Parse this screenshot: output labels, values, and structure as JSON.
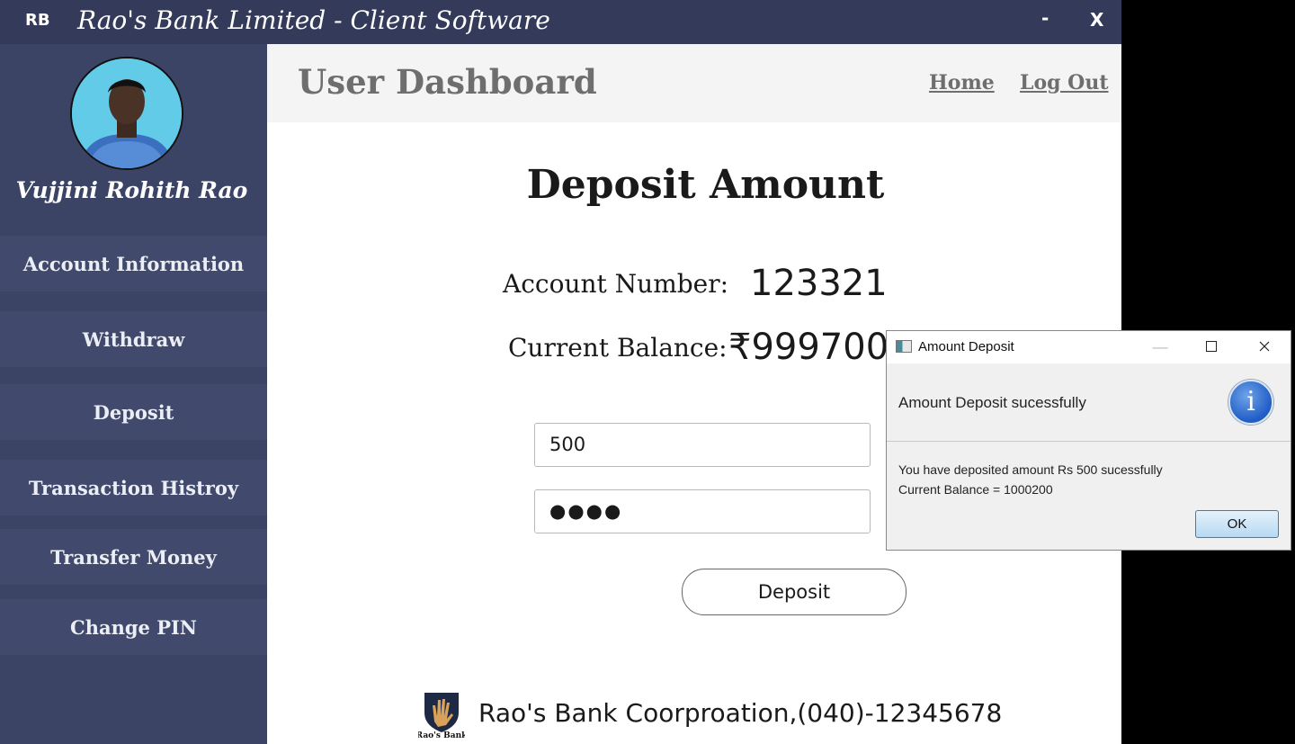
{
  "titlebar": {
    "logo": "RB",
    "title": "Rao's Bank Limited - Client Software",
    "minimize_label": "-",
    "close_label": "X"
  },
  "sidebar": {
    "user_name": "Vujjini Rohith Rao",
    "items": [
      {
        "label": "Account Information"
      },
      {
        "label": "Withdraw"
      },
      {
        "label": "Deposit"
      },
      {
        "label": "Transaction Histroy"
      },
      {
        "label": "Transfer Money"
      },
      {
        "label": "Change PIN"
      }
    ]
  },
  "header": {
    "title": "User Dashboard",
    "home_link": "Home",
    "logout_link": "Log Out"
  },
  "deposit": {
    "title": "Deposit Amount",
    "account_label": "Account Number:",
    "account_number": "123321",
    "balance_label": "Current Balance:",
    "balance_value": "₹999700",
    "amount_value": "500",
    "pin_value": "●●●●",
    "button_label": "Deposit"
  },
  "footer": {
    "logo_text": "Rao's Bank",
    "text": "Rao's Bank Coorproation,(040)-12345678"
  },
  "dialog": {
    "title": "Amount Deposit",
    "header_text": "Amount Deposit sucessfully",
    "message_line1": "You have deposited amount Rs 500 sucessfully",
    "message_line2": "Current Balance = 1000200",
    "ok_label": "OK",
    "icon": "info-icon"
  },
  "colors": {
    "titlebar": "#343a59",
    "sidebar": "#3c4466",
    "nav_item": "#414a6d",
    "accent": "#1f5cc6"
  }
}
